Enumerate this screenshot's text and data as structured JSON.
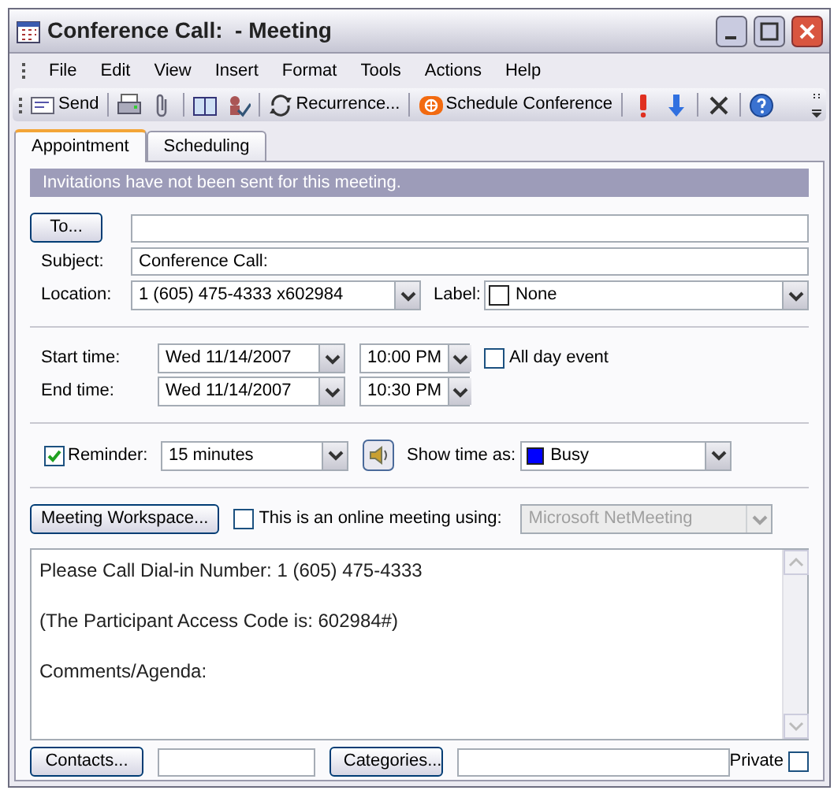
{
  "window": {
    "title": "Conference Call:  - Meeting"
  },
  "menu": [
    "File",
    "Edit",
    "View",
    "Insert",
    "Format",
    "Tools",
    "Actions",
    "Help"
  ],
  "toolbar_buttons": [
    "Send",
    "Recurrence...",
    "Schedule Conference"
  ],
  "tabs": [
    {
      "label": "Appointment",
      "selected": true
    },
    {
      "label": "Scheduling",
      "selected": false
    }
  ],
  "info_bar": "Invitations have not been sent for this meeting.",
  "to_button": "To...",
  "subject": {
    "label": "Subject:",
    "value": "Conference Call:"
  },
  "location": {
    "label": "Location:",
    "value": "1 (605) 475-4333 x602984"
  },
  "label_field": {
    "label": "Label:",
    "value": "None"
  },
  "start": {
    "label": "Start time:",
    "date": "Wed 11/14/2007",
    "time": "10:00 PM"
  },
  "end": {
    "label": "End time:",
    "date": "Wed 11/14/2007",
    "time": "10:30 PM"
  },
  "all_day": {
    "label": "All day event",
    "checked": false
  },
  "reminder": {
    "label": "Reminder:",
    "checked": true,
    "value": "15 minutes"
  },
  "show_time_as": {
    "label": "Show time as:",
    "value": "Busy",
    "color": "#0000ff"
  },
  "workspace_button": "Meeting Workspace...",
  "online": {
    "label": "This is an online meeting using:",
    "checked": false,
    "value": "Microsoft NetMeeting",
    "disabled": true
  },
  "body": [
    "Please Call Dial-in Number: 1 (605) 475-4333",
    "(The Participant Access Code is: 602984#)",
    "Comments/Agenda:"
  ],
  "contacts_button": "Contacts...",
  "categories_button": "Categories...",
  "private": {
    "label": "Private",
    "checked": false
  }
}
